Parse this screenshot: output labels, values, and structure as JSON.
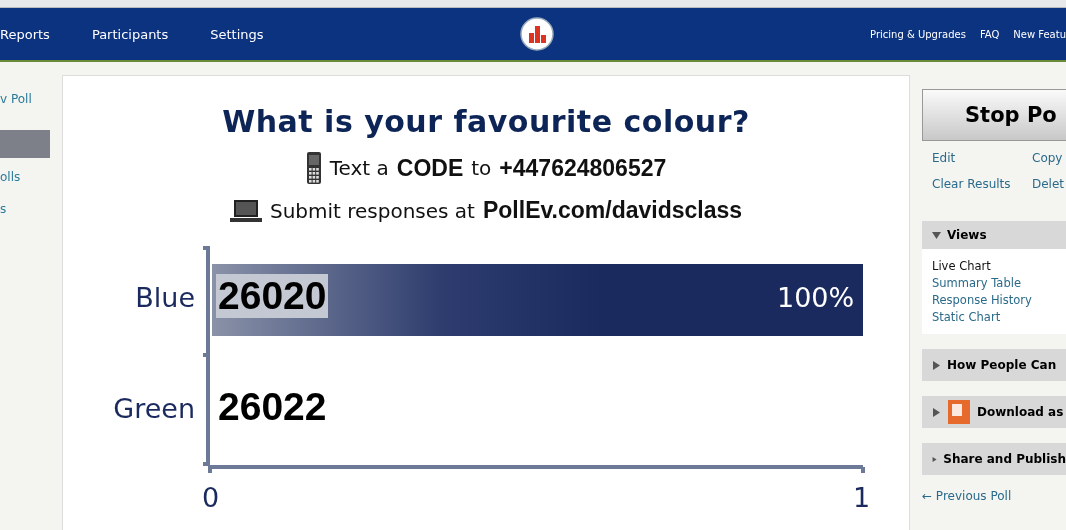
{
  "nav": {
    "left": [
      "Reports",
      "Participants",
      "Settings"
    ],
    "right": [
      "Pricing & Upgrades",
      "FAQ",
      "New Featu"
    ]
  },
  "sidebar": {
    "items": [
      {
        "label": "v Poll",
        "selected": false
      },
      {
        "selected": true
      },
      {
        "label": "olls",
        "selected": false
      },
      {
        "label": "s",
        "selected": false
      }
    ]
  },
  "poll": {
    "title": "What is your favourite colour?",
    "text_line": {
      "prefix": "Text a",
      "code": "CODE",
      "middle": "to",
      "number": "+447624806527"
    },
    "web_line": {
      "prefix": "Submit responses at",
      "url": "PollEv.com/davidsclass"
    },
    "codes": [
      "26020",
      "26022"
    ],
    "chart_data": {
      "type": "bar",
      "orientation": "horizontal",
      "categories": [
        "Blue",
        "Green"
      ],
      "series": [
        {
          "color": "#1b2a5e",
          "values": [
            1,
            0
          ]
        }
      ],
      "xlim": [
        0,
        1
      ],
      "xticks": [
        0,
        1
      ],
      "value_labels": [
        "100%",
        null
      ]
    }
  },
  "actions": {
    "primary": "Stop Po",
    "links": [
      "Edit",
      "Copy",
      "Clear Results",
      "Delet"
    ]
  },
  "views": {
    "title": "Views",
    "expanded": true,
    "items": [
      {
        "label": "Live Chart",
        "selected": true
      },
      {
        "label": "Summary Table",
        "selected": false
      },
      {
        "label": "Response History",
        "selected": false
      },
      {
        "label": "Static Chart",
        "selected": false
      }
    ]
  },
  "sections": [
    {
      "title": "How People Can",
      "kind": "plain"
    },
    {
      "title": "Download as",
      "kind": "powerpoint"
    },
    {
      "title": "Share and Publish",
      "kind": "plain"
    }
  ],
  "previous": "← Previous Poll"
}
